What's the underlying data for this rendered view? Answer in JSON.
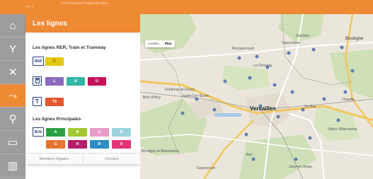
{
  "header": {
    "logo_text": "ꞈꞈꞈ",
    "tagline": "Communauté d'agglomération",
    "brand_color": "#ef8a34"
  },
  "nav": [
    {
      "icon": "home-icon",
      "glyph": "⌂"
    },
    {
      "icon": "fork-icon",
      "glyph": "Y"
    },
    {
      "icon": "cross-routes-icon",
      "glyph": "✕"
    },
    {
      "icon": "lines-icon",
      "glyph": "⤳"
    },
    {
      "icon": "bike-icon",
      "glyph": "⚲"
    },
    {
      "icon": "car-icon",
      "glyph": "▭"
    },
    {
      "icon": "building-icon",
      "glyph": "▥"
    }
  ],
  "panel": {
    "title": "Les lignes",
    "rer_title": "Les lignes RER, Train et Tramway",
    "rer_badge": "RER",
    "rer_lines": [
      {
        "label": "C",
        "color": "#e3c913",
        "text": "#6b5a00"
      }
    ],
    "train_badge": "",
    "train_lines": [
      {
        "label": "L",
        "color": "#8a6bbd",
        "text": "#ffffff"
      },
      {
        "label": "N",
        "color": "#34b6a4",
        "text": "#ffffff"
      },
      {
        "label": "U",
        "color": "#c4135b",
        "text": "#ffffff"
      }
    ],
    "tram_badge": "T",
    "tram_lines": [
      {
        "label": "T6",
        "color": "#e5572b",
        "text": "#ffffff"
      }
    ],
    "bus_title": "Les lignes Principales",
    "bus_badge": "BUS",
    "bus_lines": [
      {
        "label": "A",
        "color": "#2aa043",
        "text": "#ffffff"
      },
      {
        "label": "B",
        "color": "#a3c831",
        "text": "#ffffff"
      },
      {
        "label": "C",
        "color": "#e89bc7",
        "text": "#ffffff"
      },
      {
        "label": "D",
        "color": "#9ad4dd",
        "text": "#ffffff"
      },
      {
        "label": "G",
        "color": "#e8732e",
        "text": "#ffffff"
      },
      {
        "label": "H",
        "color": "#b31f6b",
        "text": "#ffffff"
      },
      {
        "label": "R",
        "color": "#2e8ec5",
        "text": "#ffffff"
      },
      {
        "label": "9",
        "color": "#e3357a",
        "text": "#ffffff"
      }
    ],
    "footer_legal": "Mentions légales",
    "footer_contact": "Contact"
  },
  "map": {
    "type_satellite": "Satellite",
    "type_plan": "Plan",
    "places": {
      "garches": "Garches",
      "vaucresson": "Vaucresson",
      "boulogne": "Boulogne",
      "rocquencourt": "Rocquencourt",
      "le_chesnay": "Le Chesnay",
      "fontenay": "Fontenay-le-Fleury",
      "saint_cyr": "Saint-Cyr-l'École",
      "bois_arcy": "Bois-d'Arcy",
      "versailles": "Versailles",
      "viroflay": "Viroflay",
      "chaville": "Chaville",
      "velizy": "Vélizy-Villacoublay",
      "montigny": "Montigny-le-Bretonneux",
      "guyancourt": "Guyancourt",
      "jouy": "Jouy-en-Josas",
      "buc": "Buc"
    }
  }
}
